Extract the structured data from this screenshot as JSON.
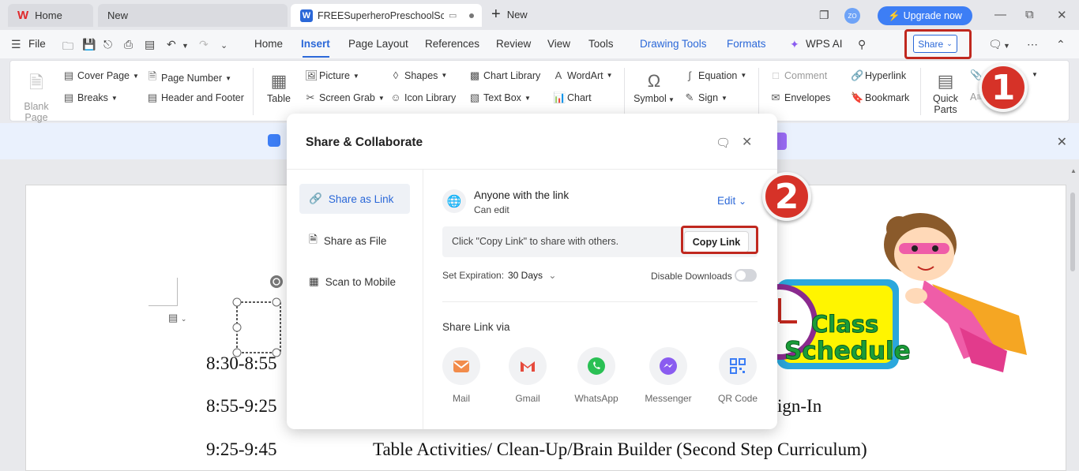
{
  "titlebar": {
    "tabs": [
      {
        "label": "Home"
      },
      {
        "label": "New"
      },
      {
        "label": "FREESuperheroPreschoolSche..."
      }
    ],
    "new_tab_label": "New",
    "avatar_initials": "ZO",
    "upgrade_label": "Upgrade now"
  },
  "menubar": {
    "file_label": "File",
    "items": [
      "Home",
      "Insert",
      "Page Layout",
      "References",
      "Review",
      "View",
      "Tools",
      "Drawing Tools",
      "Formats",
      "WPS AI"
    ],
    "share_label": "Share"
  },
  "ribbon": {
    "blank_page": "Blank Page",
    "cover_page": "Cover Page",
    "breaks": "Breaks",
    "page_number": "Page Number",
    "header_footer": "Header and  Footer",
    "table": "Table",
    "picture": "Picture",
    "screen_grab": "Screen Grab",
    "shapes": "Shapes",
    "icon_library": "Icon  Library",
    "chart_library": "Chart  Library",
    "text_box": "Text Box",
    "wordart": "WordArt",
    "chart": "Chart",
    "symbol": "Symbol",
    "equation": "Equation",
    "sign": "Sign",
    "comment": "Comment",
    "envelopes": "Envelopes",
    "hyperlink": "Hyperlink",
    "bookmark": "Bookmark",
    "quick_parts": "Quick Parts"
  },
  "document": {
    "lines": [
      {
        "time": "8:30-8:55",
        "activity": ""
      },
      {
        "time": "8:55-9:25",
        "activity": "ign-In"
      },
      {
        "time": "9:25-9:45",
        "activity": "Table Activities/ Clean-Up/Brain Builder (Second Step Curriculum)"
      }
    ],
    "clipart_text": [
      "Class",
      "Schedule"
    ]
  },
  "dialog": {
    "title": "Share & Collaborate",
    "sidebar": [
      {
        "label": "Share as Link",
        "active": true
      },
      {
        "label": "Share as File",
        "active": false
      },
      {
        "label": "Scan to Mobile",
        "active": false
      }
    ],
    "permission_title": "Anyone with the link",
    "permission_sub": "Can edit",
    "edit_label": "Edit",
    "link_hint": "Click \"Copy Link\" to share with others.",
    "copy_button": "Copy Link",
    "expiration_label": "Set Expiration:",
    "expiration_value": "30 Days",
    "disable_downloads_label": "Disable Downloads",
    "disable_downloads_on": false,
    "share_via_label": "Share Link via",
    "share_options": [
      {
        "label": "Mail",
        "icon": "mail-icon",
        "color": "#f28c4b"
      },
      {
        "label": "Gmail",
        "icon": "gmail-icon",
        "color": "#e64a3c"
      },
      {
        "label": "WhatsApp",
        "icon": "whatsapp-icon",
        "color": "#2ac054"
      },
      {
        "label": "Messenger",
        "icon": "messenger-icon",
        "color": "#8a5cf0"
      },
      {
        "label": "QR Code",
        "icon": "qr-code-icon",
        "color": "#3d7ef5"
      }
    ]
  },
  "annotations": {
    "step1": "1",
    "step2": "2"
  },
  "colors": {
    "accent": "#2b68d8",
    "highlight_box": "#c0281f",
    "badge": "#d63228"
  }
}
